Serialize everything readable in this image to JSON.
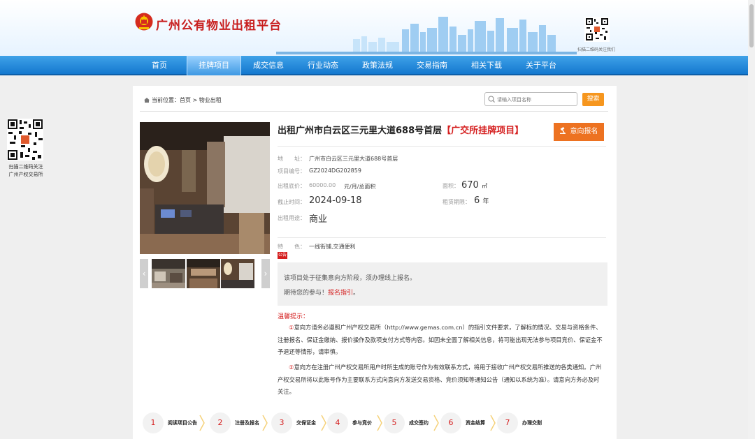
{
  "site": {
    "title": "广州公有物业出租平台",
    "qr_caption": "扫描二维码关注我们"
  },
  "nav": {
    "items": [
      "首页",
      "挂牌项目",
      "成交信息",
      "行业动态",
      "政策法规",
      "交易指南",
      "相关下载",
      "关于平台"
    ],
    "active": "挂牌项目"
  },
  "side_qr": {
    "caption_line1": "扫描二维码关注",
    "caption_line2": "广州产权交易所"
  },
  "breadcrumb": {
    "label": "当前位置：",
    "home": "首页",
    "separator": " > ",
    "current": "物业出租"
  },
  "search": {
    "placeholder": "请输入项目名称",
    "button": "搜索"
  },
  "listing": {
    "title": "出租广州市白云区三元里大道688号首层",
    "tag": "【广交所挂牌项目】",
    "apply_button": "意向报名",
    "address_label": "地　　址：",
    "address": "广州市白云区三元里大道688号首层",
    "code_label": "项目编号：",
    "code": "GZ2024DG202859",
    "price_label": "出租底价：",
    "price": "60000.00",
    "price_unit": "元/月/总面积",
    "area_label": "面积：",
    "area": "670",
    "area_unit": "㎡",
    "deadline_label": "截止时间：",
    "deadline": "2024-09-18",
    "term_label": "租赁期限：",
    "term": "6",
    "term_unit": "年",
    "use_label": "出租用途：",
    "use": "商业",
    "feature_label": "特　　色：",
    "feature": "一线街铺,交通便利",
    "badge": "公告"
  },
  "notice": {
    "line1": "该项目处于征集意向方阶段，须办理线上报名。",
    "line2_prefix": "期待您的参与！",
    "line2_link": "报名指引",
    "line2_suffix": "。"
  },
  "tips": {
    "title": "温馨提示：",
    "p1_num": "①",
    "p1": "意向方请务必遵照广州产权交易所（http://www.gemas.com.cn）的指引文件要求，了解标的情况、交易与资格条件、注册报名、保证金缴纳、报价操作及款项支付方式等内容。如因未全面了解相关信息，将可能出现无法参与项目竞价、保证金不予退还等情形，请审慎。",
    "p2_num": "②",
    "p2": "意向方在注册广州产权交易所用户时所生成的账号作为有效联系方式，将用于接收广州产权交易所推送的各类通知。广州产权交易所将以此账号作为主要联系方式向意向方发送交易资格、竞价须知等通知公告（通知以系统为准）。请意向方务必及时关注。"
  },
  "steps": [
    {
      "num": "1",
      "label": "阅读项目公告"
    },
    {
      "num": "2",
      "label": "注册及报名"
    },
    {
      "num": "3",
      "label": "交保证金"
    },
    {
      "num": "4",
      "label": "参与竞价"
    },
    {
      "num": "5",
      "label": "成交签约"
    },
    {
      "num": "6",
      "label": "资金结算"
    },
    {
      "num": "7",
      "label": "办理交割"
    }
  ],
  "colors": {
    "brand_red": "#d51f1f",
    "nav_blue": "#1478cf",
    "orange": "#ed7221"
  }
}
